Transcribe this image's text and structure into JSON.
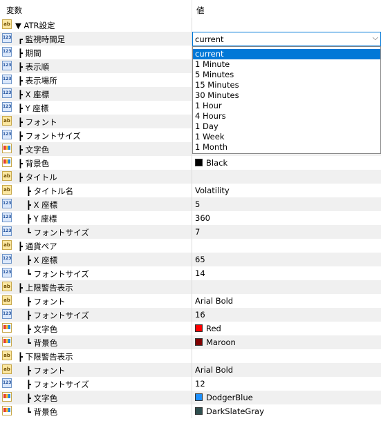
{
  "header": {
    "col_variable": "変数",
    "col_value": "値"
  },
  "rows": [
    {
      "icon": "ab",
      "name": "▼ ATR設定",
      "value": ""
    },
    {
      "icon": "123",
      "name": "┏ 監視時間足",
      "value": ""
    },
    {
      "icon": "123",
      "name": "┣ 期間",
      "value": ""
    },
    {
      "icon": "123",
      "name": "┣ 表示順",
      "value": ""
    },
    {
      "icon": "123",
      "name": "┣ 表示場所",
      "value": ""
    },
    {
      "icon": "123",
      "name": "┣ X 座標",
      "value": ""
    },
    {
      "icon": "123",
      "name": "┣ Y 座標",
      "value": ""
    },
    {
      "icon": "ab",
      "name": "┣ フォント",
      "value": ""
    },
    {
      "icon": "123",
      "name": "┣ フォントサイズ",
      "value": ""
    },
    {
      "icon": "color",
      "name": "┣ 文字色",
      "value": ""
    },
    {
      "icon": "color",
      "name": "┣ 背景色",
      "value": "Black",
      "swatch": "#000000"
    },
    {
      "icon": "ab",
      "name": "┣ タイトル",
      "value": ""
    },
    {
      "icon": "ab",
      "name": "┣ タイトル名",
      "value": "Volatility"
    },
    {
      "icon": "123",
      "name": "┣ X 座標",
      "value": "5"
    },
    {
      "icon": "123",
      "name": "┣ Y 座標",
      "value": "360"
    },
    {
      "icon": "123",
      "name": "┗ フォントサイズ",
      "value": "7"
    },
    {
      "icon": "ab",
      "name": "┣ 通貨ペア",
      "value": ""
    },
    {
      "icon": "123",
      "name": "┣ X 座標",
      "value": "65"
    },
    {
      "icon": "123",
      "name": "┗ フォントサイズ",
      "value": "14"
    },
    {
      "icon": "ab",
      "name": "┣ 上限警告表示",
      "value": ""
    },
    {
      "icon": "ab",
      "name": "┣ フォント",
      "value": "Arial Bold"
    },
    {
      "icon": "123",
      "name": "┣ フォントサイズ",
      "value": "16"
    },
    {
      "icon": "color",
      "name": "┣ 文字色",
      "value": "Red",
      "swatch": "#ff0000"
    },
    {
      "icon": "color",
      "name": "┗ 背景色",
      "value": "Maroon",
      "swatch": "#800000"
    },
    {
      "icon": "ab",
      "name": "┣ 下限警告表示",
      "value": ""
    },
    {
      "icon": "ab",
      "name": "┣ フォント",
      "value": "Arial Bold"
    },
    {
      "icon": "123",
      "name": "┣ フォントサイズ",
      "value": "12"
    },
    {
      "icon": "color",
      "name": "┣ 文字色",
      "value": "DodgerBlue",
      "swatch": "#1e90ff"
    },
    {
      "icon": "color",
      "name": "┗ 背景色",
      "value": "DarkSlateGray",
      "swatch": "#2f4f4f"
    }
  ],
  "combo": {
    "value": "current",
    "arrow": "⌵"
  },
  "dropdown": {
    "options": [
      "current",
      "1 Minute",
      "5 Minutes",
      "15 Minutes",
      "30 Minutes",
      "1 Hour",
      "4 Hours",
      "1 Day",
      "1 Week",
      "1 Month"
    ],
    "selected": 0
  },
  "colors": {
    "accent": "#0078d7",
    "alt_row": "#f0f0f0"
  }
}
